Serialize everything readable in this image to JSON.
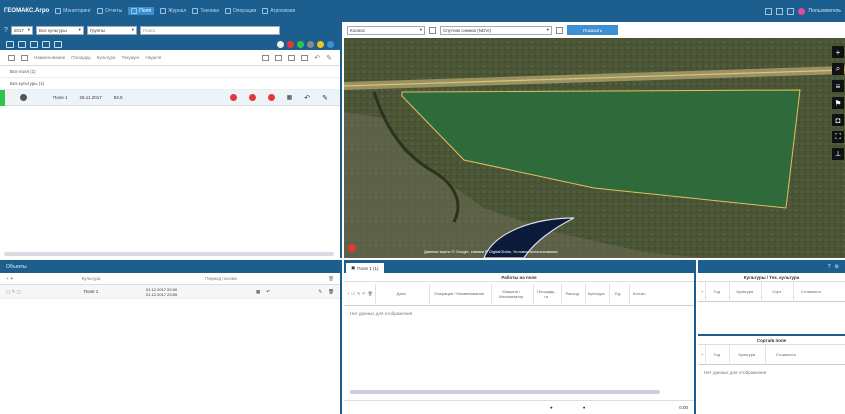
{
  "topbar": {
    "brand": "ГЕОМАКС.Агро",
    "nav": [
      {
        "label": "Мониторинг",
        "active": false
      },
      {
        "label": "Отчеты",
        "active": false
      },
      {
        "label": "Поля",
        "active": true
      },
      {
        "label": "Журнал",
        "active": false
      },
      {
        "label": "Техника",
        "active": false
      },
      {
        "label": "Операции",
        "active": false
      },
      {
        "label": "Агрохимия",
        "active": false
      }
    ],
    "user": "Пользователь"
  },
  "filters": {
    "year": "2017",
    "season": "Все культуры",
    "group": "Группы",
    "search_placeholder": "Поиск"
  },
  "status_dots": [
    "#f0f0f0",
    "#e23a3a",
    "#2ec44d",
    "#8a8a8a",
    "#f0c419",
    "#3f8fd4"
  ],
  "field_columns": [
    "Наименование",
    "Площадь",
    "Культура",
    "Текущее",
    "Неделя"
  ],
  "groups": [
    "Все поля (1)",
    "Без культуры (1)"
  ],
  "field_row": {
    "name": "Поле 1",
    "date": "26.11.2017",
    "area": "93.9"
  },
  "map": {
    "layer": "Космос",
    "style": "Спутник снимок (NDVI)",
    "button": "Показать",
    "attribution": "Данные карты © Google, снимки © DigitalGlobe, Условия использования"
  },
  "bottom_left": {
    "title": "Объекты",
    "columns": [
      "",
      "Культура",
      "Период посева",
      ""
    ],
    "row": {
      "name": "Поле 1",
      "period1": "01.12.2017 00:00",
      "period2": "01.12.2017 23:59"
    }
  },
  "bottom_mid": {
    "tab": "Поле 1 (1)",
    "section": "Работы на поле",
    "columns": [
      "Дата",
      "Операция / Наименование",
      "Машина / Механизатор",
      "Площадь, га",
      "Расход",
      "Культура",
      "Ед.",
      "Кол-во"
    ],
    "empty": "Нет данных для отображения",
    "footer_value": "0.00"
  },
  "bottom_right": {
    "top_title": "Культуры / Тех. культура",
    "top_columns": [
      "",
      "Год",
      "Культура",
      "Сорт",
      "Стоимость"
    ],
    "bottom_title": "Сорта/в поле",
    "bottom_columns": [
      "",
      "Год",
      "Культура",
      "Стоимость"
    ],
    "empty": "Нет данных для отображения"
  }
}
